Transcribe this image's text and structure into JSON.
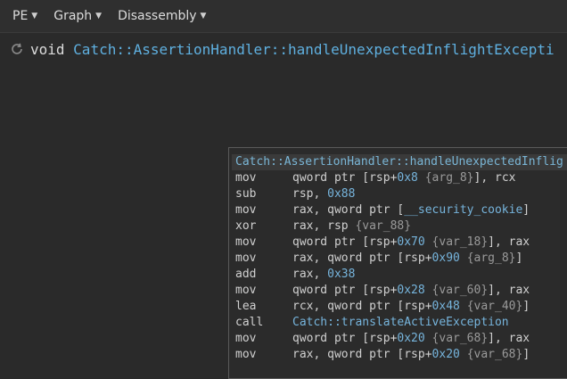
{
  "toolbar": {
    "pe_label": "PE",
    "graph_label": "Graph",
    "disassembly_label": "Disassembly"
  },
  "signature": {
    "return_type": "void",
    "function_name": "Catch::AssertionHandler::handleUnexpectedInflightExcepti"
  },
  "block": {
    "title": "Catch::AssertionHandler::handleUnexpectedInflig",
    "lines": [
      {
        "mnemonic": "mov",
        "p1": "qword ptr [rsp+",
        "p2": "0x8",
        "p3": " ",
        "p4": "{arg_8}",
        "p5": "], rcx"
      },
      {
        "mnemonic": "sub",
        "p1": "rsp, ",
        "p2": "0x88",
        "p3": "",
        "p4": "",
        "p5": ""
      },
      {
        "mnemonic": "mov",
        "p1": "rax, qword ptr [",
        "p2": "",
        "p3": "",
        "p4": "__security_cookie",
        "p5": "]"
      },
      {
        "mnemonic": "xor",
        "p1": "rax, rsp ",
        "p2": "",
        "p3": "",
        "p4": "{var_88}",
        "p5": ""
      },
      {
        "mnemonic": "mov",
        "p1": "qword ptr [rsp+",
        "p2": "0x70",
        "p3": " ",
        "p4": "{var_18}",
        "p5": "], rax"
      },
      {
        "mnemonic": "mov",
        "p1": "rax, qword ptr [rsp+",
        "p2": "0x90",
        "p3": " ",
        "p4": "{arg_8}",
        "p5": "]"
      },
      {
        "mnemonic": "add",
        "p1": "rax, ",
        "p2": "0x38",
        "p3": "",
        "p4": "",
        "p5": ""
      },
      {
        "mnemonic": "mov",
        "p1": "qword ptr [rsp+",
        "p2": "0x28",
        "p3": " ",
        "p4": "{var_60}",
        "p5": "], rax"
      },
      {
        "mnemonic": "lea",
        "p1": "rcx, qword ptr [rsp+",
        "p2": "0x48",
        "p3": " ",
        "p4": "{var_40}",
        "p5": "]"
      },
      {
        "mnemonic": "call",
        "p1": "",
        "p2": "",
        "p3": "",
        "p4": "Catch::translateActiveException",
        "p5": ""
      },
      {
        "mnemonic": "mov",
        "p1": "qword ptr [rsp+",
        "p2": "0x20",
        "p3": " ",
        "p4": "{var_68}",
        "p5": "], rax"
      },
      {
        "mnemonic": "mov",
        "p1": "rax, qword ptr [rsp+",
        "p2": "0x20",
        "p3": " ",
        "p4": "{var_68}",
        "p5": "]"
      }
    ]
  }
}
